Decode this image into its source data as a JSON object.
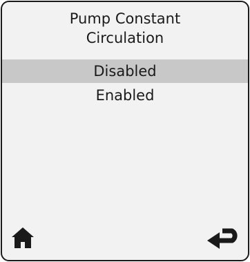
{
  "screen": {
    "title_line1": "Pump Constant",
    "title_line2": "Circulation"
  },
  "options": [
    {
      "label": "Disabled",
      "selected": true
    },
    {
      "label": "Enabled",
      "selected": false
    }
  ],
  "footer": {
    "home_icon": "home-icon",
    "back_icon": "return-arrow-icon"
  },
  "colors": {
    "background": "#f2f2f2",
    "selected_row": "#c8c8c8",
    "text": "#1a1a1a"
  }
}
